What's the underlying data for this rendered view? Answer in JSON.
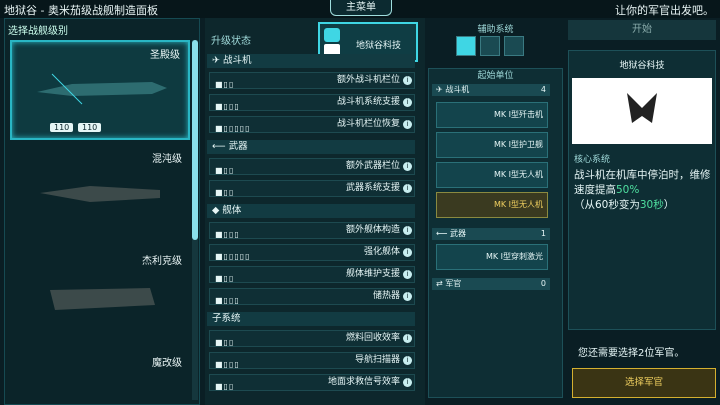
{
  "window": {
    "title": "地狱谷 - 奥米茄级战舰制造面板",
    "main_menu": "主菜单",
    "message": "让你的军官出发吧。"
  },
  "left": {
    "header": "选择战舰级别",
    "ships": [
      {
        "name": "圣殿级",
        "badges": [
          "110",
          "110"
        ]
      },
      {
        "name": "混沌级"
      },
      {
        "name": "杰利克级"
      },
      {
        "name": "魔改级"
      }
    ]
  },
  "upgrades": {
    "header": "升级状态",
    "hero_label": "地狱谷科技",
    "sections": [
      {
        "title": "战斗机",
        "rows": [
          {
            "pips": "■▯▯",
            "label": "额外战斗机栏位"
          },
          {
            "pips": "■▯▯▯",
            "label": "战斗机系统支援"
          },
          {
            "pips": "■▯▯▯▯▯",
            "label": "战斗机栏位恢复"
          }
        ]
      },
      {
        "title": "武器",
        "rows": [
          {
            "pips": "■▯▯",
            "label": "额外武器栏位"
          },
          {
            "pips": "■▯▯",
            "label": "武器系统支援"
          }
        ]
      },
      {
        "title": "舰体",
        "rows": [
          {
            "pips": "■▯▯▯",
            "label": "额外舰体构造"
          },
          {
            "pips": "■▯▯▯▯▯",
            "label": "强化舰体"
          },
          {
            "pips": "■▯▯",
            "label": "舰体维护支援"
          },
          {
            "pips": "■▯▯▯",
            "label": "储热器"
          }
        ]
      },
      {
        "title": "子系统",
        "rows": [
          {
            "pips": "■▯▯",
            "label": "燃料回收效率"
          },
          {
            "pips": "■▯▯▯",
            "label": "导航扫描器"
          },
          {
            "pips": "■▯▯",
            "label": "地面求救信号效率"
          }
        ]
      }
    ]
  },
  "aux": {
    "header": "辅助系统"
  },
  "start_units": {
    "header": "起始单位",
    "fighters": {
      "title": "战斗机",
      "count": "4",
      "units": [
        "MK I型歼击机",
        "MK I型护卫舰",
        "MK I型无人机",
        "MK I型无人机"
      ]
    },
    "weapons": {
      "title": "武器",
      "count": "1",
      "units": [
        "MK I型穿刺激光"
      ]
    },
    "officers": {
      "title": "军官",
      "count": "0"
    }
  },
  "right": {
    "start": "开始",
    "card_title": "地狱谷科技",
    "core": "核心系统",
    "desc_a": "战斗机在机库中停泊时，维修速度提高",
    "desc_pct": "50%",
    "desc_b": "（从60秒变为",
    "desc_sec": "30秒",
    "desc_c": "）",
    "need": "您还需要选择2位军官。",
    "select_btn": "选择军官"
  }
}
